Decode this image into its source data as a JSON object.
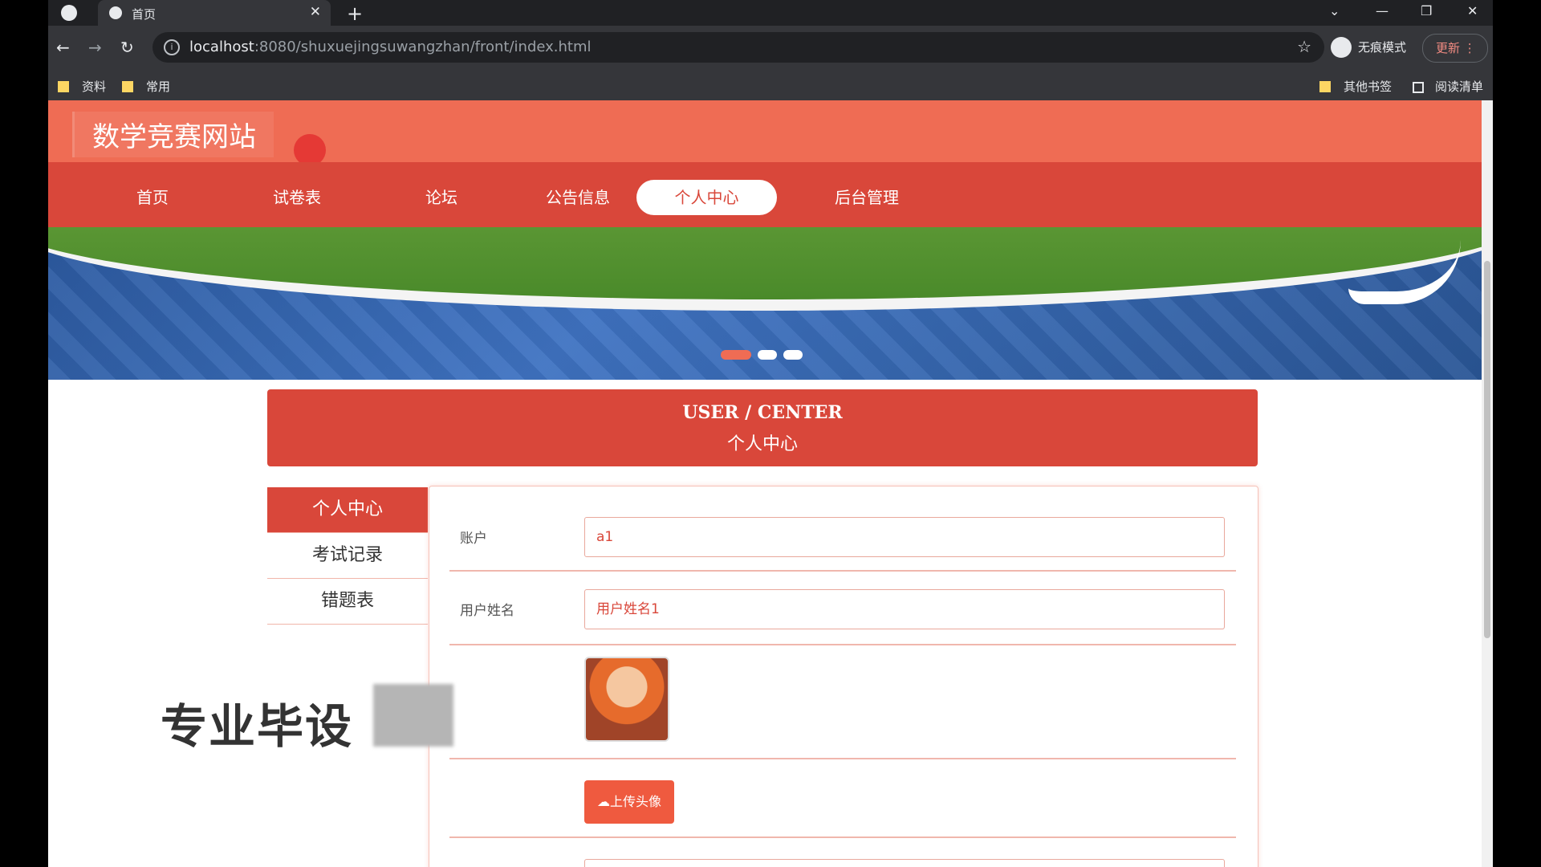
{
  "browser": {
    "tab_title": "首页",
    "url_host": "localhost",
    "url_rest": ":8080/shuxuejingsuwangzhan/front/index.html",
    "incognito_label": "无痕模式",
    "update_label": "更新",
    "bookmarks": [
      "资料",
      "常用"
    ],
    "other_bookmarks": "其他书签",
    "reading_list": "阅读清单"
  },
  "site": {
    "logo": "数学竞赛网站",
    "nav": [
      {
        "label": "首页"
      },
      {
        "label": "试卷表"
      },
      {
        "label": "论坛"
      },
      {
        "label": "公告信息"
      },
      {
        "label": "个人中心"
      },
      {
        "label": "后台管理"
      }
    ],
    "active_nav": "个人中心"
  },
  "user_center": {
    "title_en": "USER / CENTER",
    "title_cn": "个人中心",
    "sidebar": [
      {
        "label": "个人中心"
      },
      {
        "label": "考试记录"
      },
      {
        "label": "错题表"
      }
    ],
    "fields": {
      "account_label": "账户",
      "account_value": "a1",
      "username_label": "用户姓名",
      "username_value": "用户姓名1"
    },
    "upload_button": "上传头像"
  },
  "overlay": {
    "watermark": "专业毕设"
  },
  "colors": {
    "header": "#ef6c54",
    "nav": "#d9473a",
    "accent": "#ef5a3f"
  }
}
